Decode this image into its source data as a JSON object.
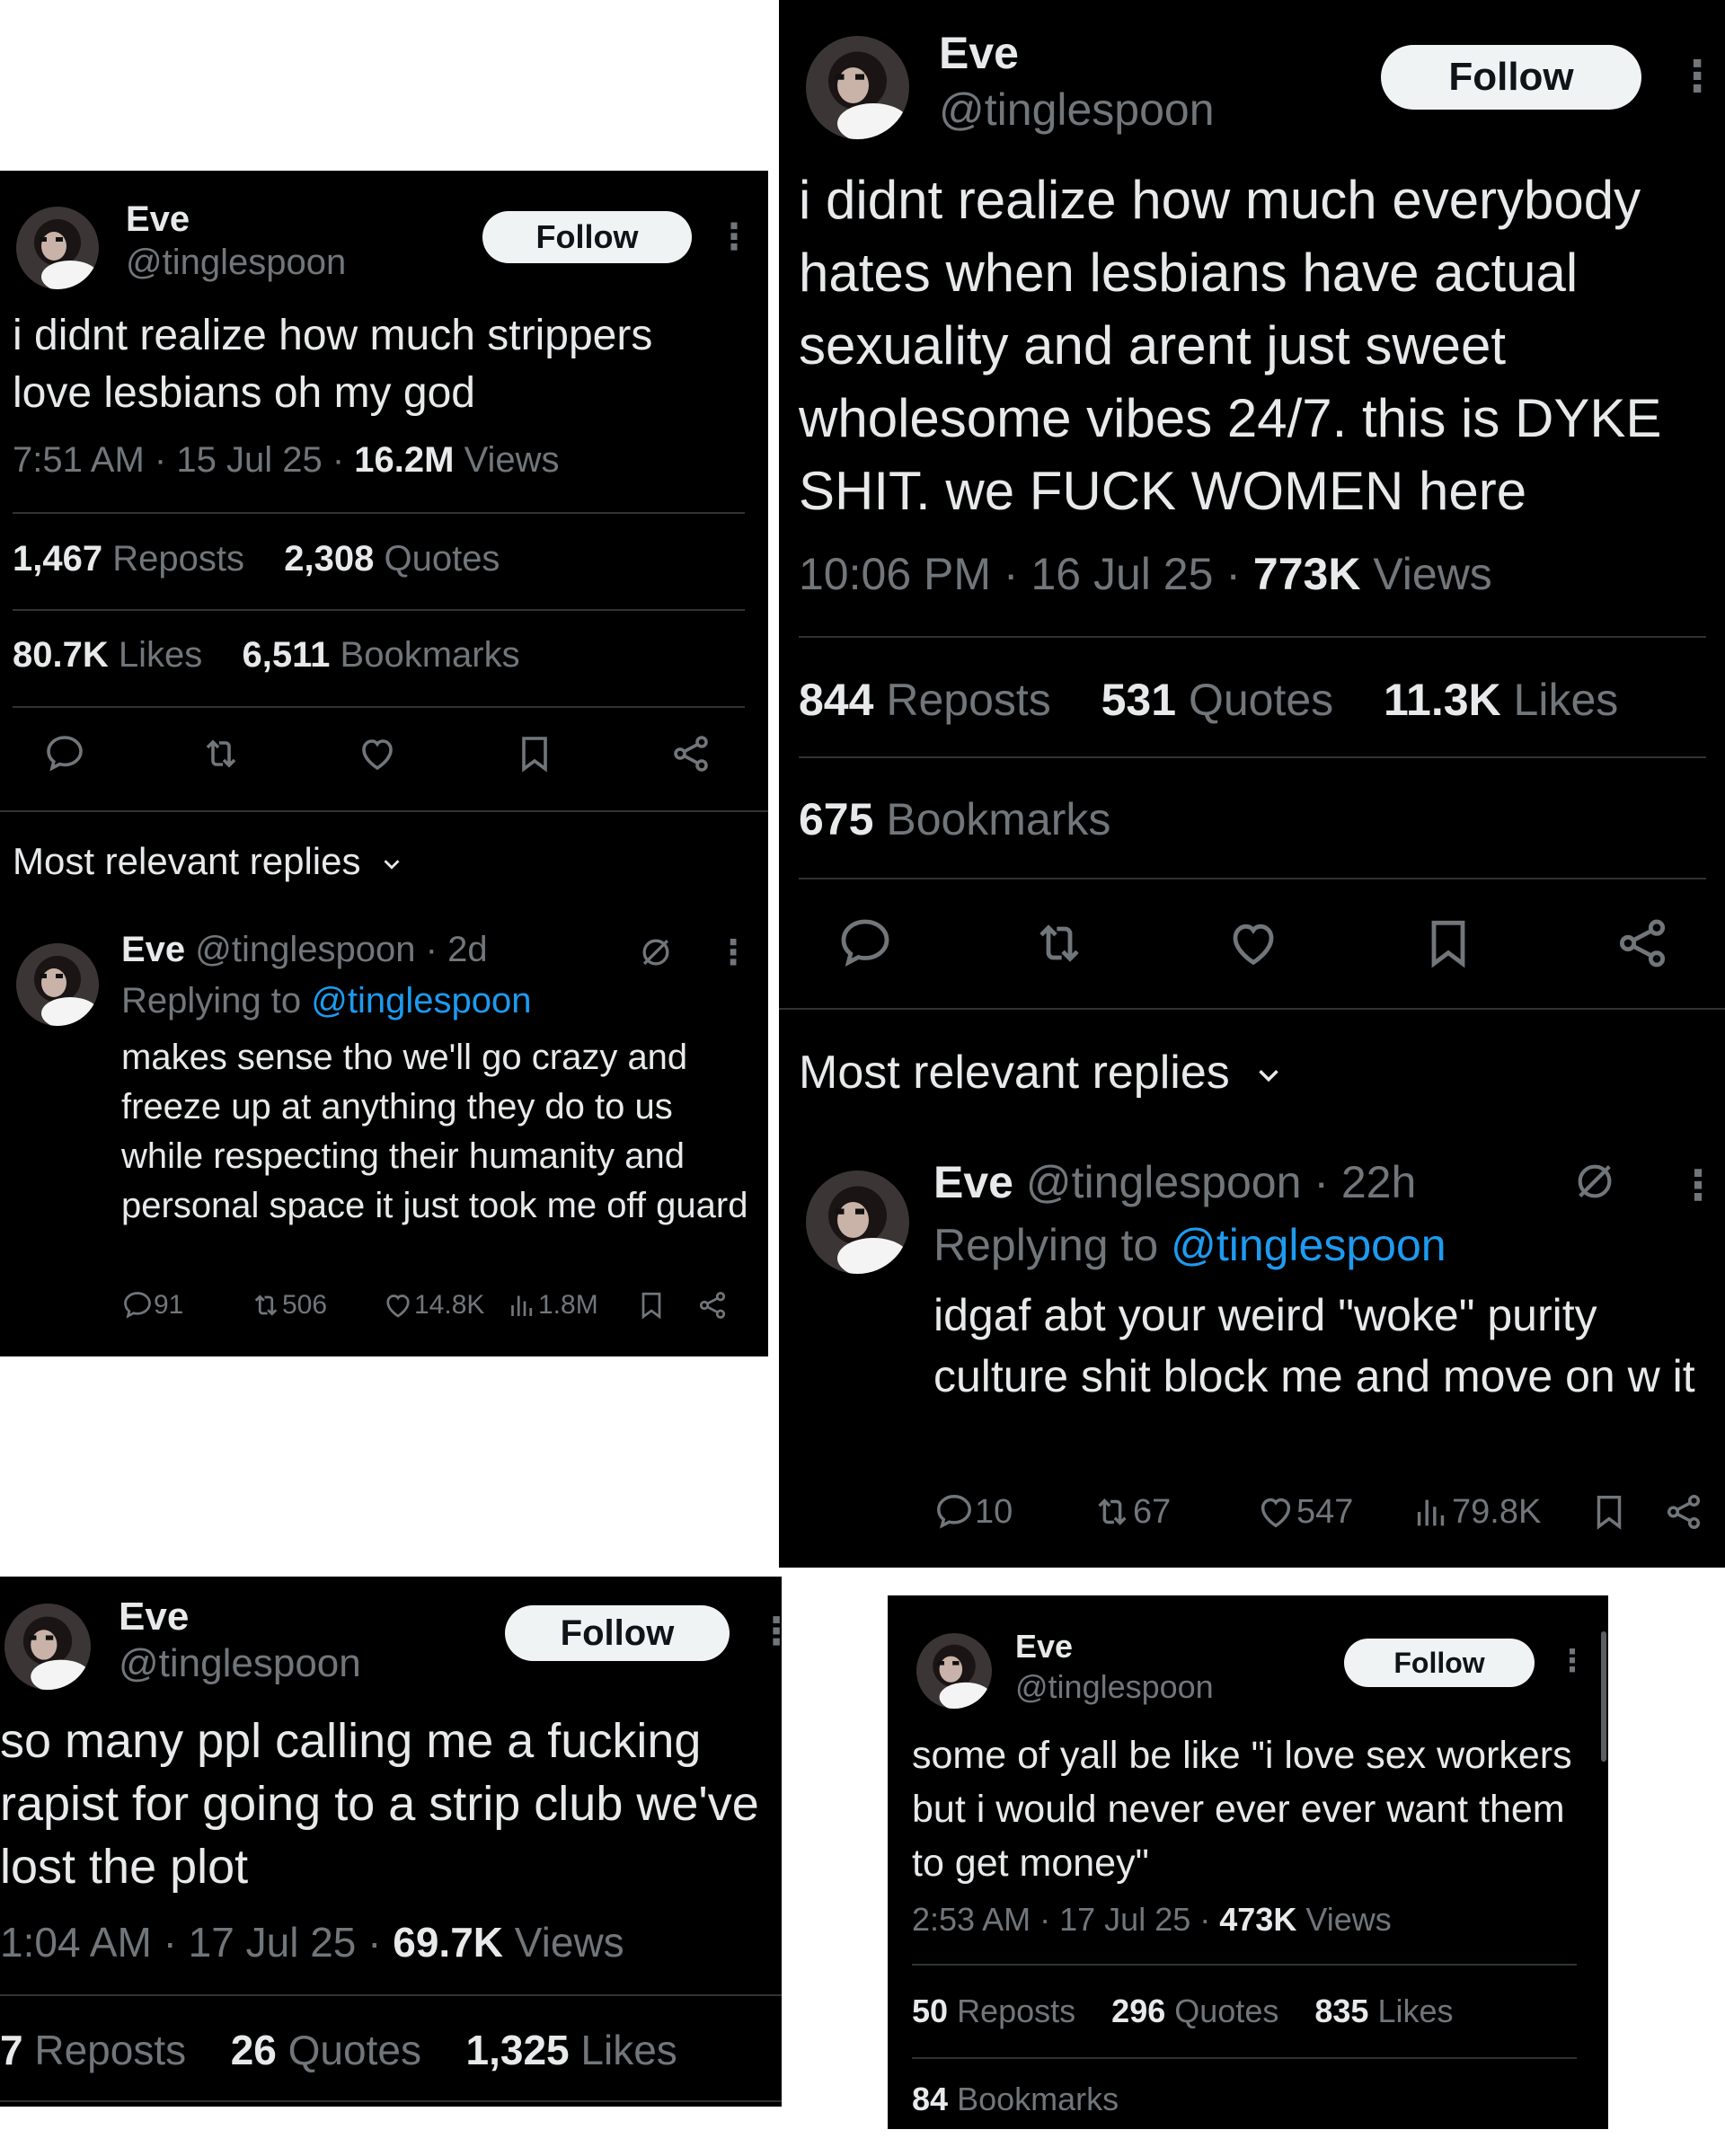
{
  "colors": {
    "background": "#000000",
    "text": "#e7e9ea",
    "muted": "#71767b",
    "divider": "#2f3336",
    "link": "#1d9bf0",
    "follow_bg": "#eff3f4"
  },
  "tweet1": {
    "name": "Eve",
    "handle": "@tinglespoon",
    "follow_label": "Follow",
    "more_icon": "⋮",
    "text": "i didnt realize how much strippers love lesbians oh my god",
    "time": "7:51 AM",
    "date": "15 Jul 25",
    "views_count": "16.2M",
    "views_label": "Views",
    "reposts_count": "1,467",
    "reposts_label": "Reposts",
    "quotes_count": "2,308",
    "quotes_label": "Quotes",
    "likes_count": "80.7K",
    "likes_label": "Likes",
    "bookmarks_count": "6,511",
    "bookmarks_label": "Bookmarks",
    "replies_header": "Most relevant replies",
    "reply": {
      "name": "Eve",
      "handle": "@tinglespoon",
      "age": "2d",
      "replying_prefix": "Replying to",
      "replying_handle": "@tinglespoon",
      "text": "makes sense tho we'll go crazy and freeze up at anything they do to us while respecting their humanity and personal space it just took me off guard",
      "reply_count": "91",
      "repost_count": "506",
      "like_count": "14.8K",
      "view_count": "1.8M"
    }
  },
  "tweet2": {
    "name": "Eve",
    "handle": "@tinglespoon",
    "follow_label": "Follow",
    "more_icon": "⋮",
    "text": "i didnt realize how much everybody hates when lesbians have actual sexuality and arent just sweet wholesome vibes 24/7. this is DYKE SHIT. we FUCK WOMEN here",
    "time": "10:06 PM",
    "date": "16 Jul 25",
    "views_count": "773K",
    "views_label": "Views",
    "reposts_count": "844",
    "reposts_label": "Reposts",
    "quotes_count": "531",
    "quotes_label": "Quotes",
    "likes_count": "11.3K",
    "likes_label": "Likes",
    "bookmarks_count": "675",
    "bookmarks_label": "Bookmarks",
    "replies_header": "Most relevant replies",
    "reply": {
      "name": "Eve",
      "handle": "@tinglespoon",
      "age": "22h",
      "replying_prefix": "Replying to",
      "replying_handle": "@tinglespoon",
      "text": "idgaf abt your weird \"woke\" purity culture shit block me and move on w it",
      "reply_count": "10",
      "repost_count": "67",
      "like_count": "547",
      "view_count": "79.8K"
    }
  },
  "tweet3": {
    "name": "Eve",
    "handle": "@tinglespoon",
    "follow_label": "Follow",
    "more_icon": "⋮",
    "text": "so many ppl calling me a fucking rapist for going to a strip club we've lost the plot",
    "time": "1:04 AM",
    "date": "17 Jul 25",
    "views_count": "69.7K",
    "views_label": "Views",
    "reposts_count": "7",
    "reposts_label": "Reposts",
    "quotes_count": "26",
    "quotes_label": "Quotes",
    "likes_count": "1,325",
    "likes_label": "Likes"
  },
  "tweet4": {
    "name": "Eve",
    "handle": "@tinglespoon",
    "follow_label": "Follow",
    "more_icon": "⋮",
    "text": "some of yall be like \"i love sex workers but i would never ever ever want them to get money\"",
    "time": "2:53 AM",
    "date": "17 Jul 25",
    "views_count": "473K",
    "views_label": "Views",
    "reposts_count": "50",
    "reposts_label": "Reposts",
    "quotes_count": "296",
    "quotes_label": "Quotes",
    "likes_count": "835",
    "likes_label": "Likes",
    "bookmarks_count": "84",
    "bookmarks_label": "Bookmarks"
  },
  "separators": {
    "dot": "·"
  }
}
